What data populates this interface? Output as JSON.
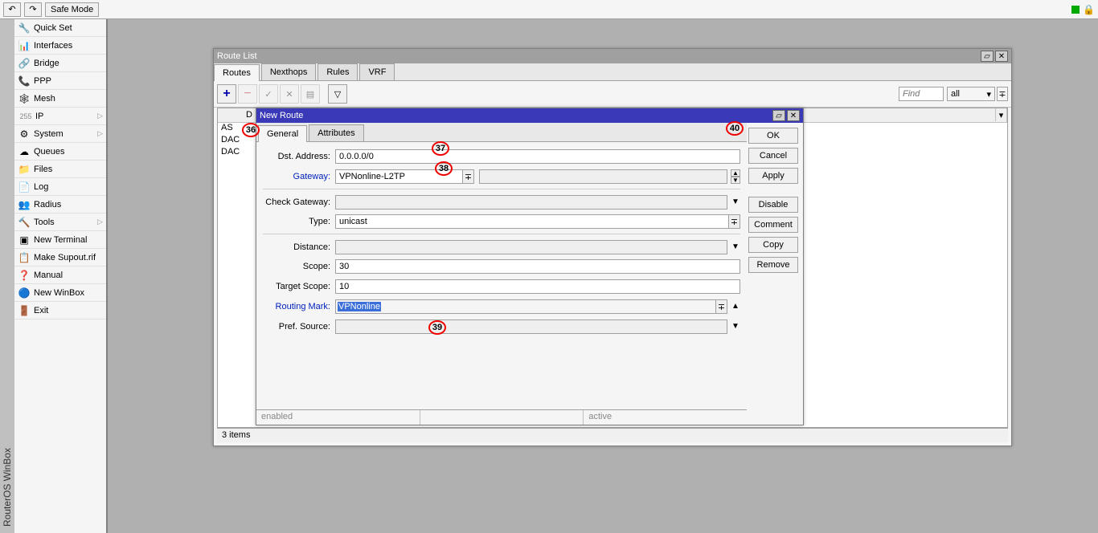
{
  "toolbar": {
    "safe_mode": "Safe Mode"
  },
  "vert_title": "RouterOS WinBox",
  "sidebar": {
    "items": [
      {
        "label": "Quick Set",
        "icon": "🔧"
      },
      {
        "label": "Interfaces",
        "icon": "📊"
      },
      {
        "label": "Bridge",
        "icon": "🔗"
      },
      {
        "label": "PPP",
        "icon": "📞"
      },
      {
        "label": "Mesh",
        "icon": "🕸"
      },
      {
        "label": "IP",
        "sub": "",
        "icon": "255",
        "chev": "▷"
      },
      {
        "label": "System",
        "icon": "⚙",
        "chev": "▷"
      },
      {
        "label": "Queues",
        "icon": "☁"
      },
      {
        "label": "Files",
        "icon": "📁"
      },
      {
        "label": "Log",
        "icon": "📄"
      },
      {
        "label": "Radius",
        "icon": "👥"
      },
      {
        "label": "Tools",
        "icon": "🔨",
        "chev": "▷"
      },
      {
        "label": "New Terminal",
        "icon": "▣"
      },
      {
        "label": "Make Supout.rif",
        "icon": "📋"
      },
      {
        "label": "Manual",
        "icon": "❓"
      },
      {
        "label": "New WinBox",
        "icon": "🔵"
      },
      {
        "label": "Exit",
        "icon": "🚪"
      }
    ]
  },
  "route_list": {
    "title": "Route List",
    "tabs": [
      "Routes",
      "Nexthops",
      "Rules",
      "VRF"
    ],
    "active_tab": 0,
    "find_placeholder": "Find",
    "filter_value": "all",
    "flag_col_label": "D",
    "rows": [
      "AS",
      "DAC",
      "DAC"
    ],
    "footer": "3 items"
  },
  "new_route": {
    "title": "New Route",
    "tabs": [
      "General",
      "Attributes"
    ],
    "active_tab": 0,
    "labels": {
      "dst": "Dst. Address:",
      "gateway": "Gateway:",
      "check_gw": "Check Gateway:",
      "type": "Type:",
      "distance": "Distance:",
      "scope": "Scope:",
      "target_scope": "Target Scope:",
      "routing_mark": "Routing Mark:",
      "pref_src": "Pref. Source:"
    },
    "values": {
      "dst": "0.0.0.0/0",
      "gateway": "VPNonline-L2TP",
      "check_gw": "",
      "type": "unicast",
      "distance": "",
      "scope": "30",
      "target_scope": "10",
      "routing_mark": "VPNonline",
      "pref_src": ""
    },
    "status": {
      "enabled": "enabled",
      "mid": "",
      "active": "active"
    },
    "buttons": [
      "OK",
      "Cancel",
      "Apply",
      "Disable",
      "Comment",
      "Copy",
      "Remove"
    ]
  },
  "annotations": {
    "a36": "36",
    "a37": "37",
    "a38": "38",
    "a39": "39",
    "a40": "40"
  }
}
